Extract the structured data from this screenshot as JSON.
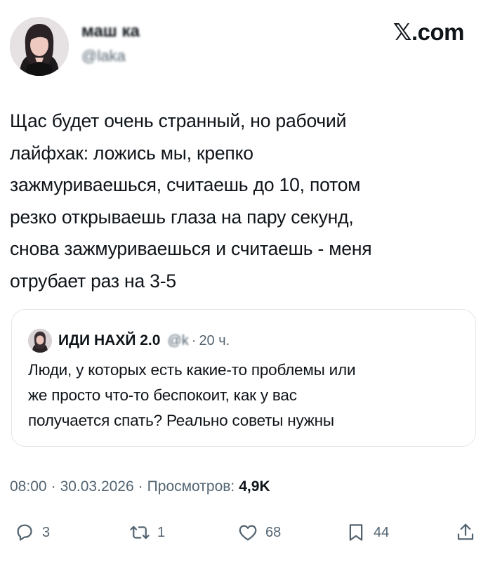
{
  "author": {
    "display_name": "маш‍‍ ‍‍ка",
    "handle": "@la‍‍‍‍‍‍‍‍ka",
    "avatar_icon": "user-avatar-photo"
  },
  "brand": {
    "label": "𝕏.com"
  },
  "tweet": {
    "text": "Щас будет очень странный, но рабочий\nлайфхак: ложись мы, крепко\nзажмуриваешься, считаешь до 10, потом\nрезко открываешь глаза на пару секунд,\nснова зажмуриваешься и считаешь - меня\nотрубает раз на 3-5"
  },
  "quote": {
    "name": "ИДИ НАХ‍Й 2.0",
    "handle": "@‍‍‍‍‍‍‍‍‍‍‍k",
    "separator": "·",
    "time": "20 ч.",
    "text": "Люди, у которых есть какие-то проблемы или\nже просто что-то беспокоит, как у вас\nполучается спать? Реально советы нужны"
  },
  "meta": {
    "time": "08:00",
    "separator": "·",
    "date": "30.03.2026",
    "views_label": "Просмотров:",
    "views_count": "4,9K"
  },
  "actions": {
    "replies": {
      "icon": "reply-icon",
      "count": "3"
    },
    "reposts": {
      "icon": "repost-icon",
      "count": "1"
    },
    "likes": {
      "icon": "like-icon",
      "count": "68"
    },
    "bookmarks": {
      "icon": "bookmark-icon",
      "count": "44"
    },
    "share": {
      "icon": "share-icon"
    }
  },
  "colors": {
    "text": "#0f1419",
    "secondary": "#536471",
    "border": "#e3e6e8",
    "background": "#ffffff"
  }
}
